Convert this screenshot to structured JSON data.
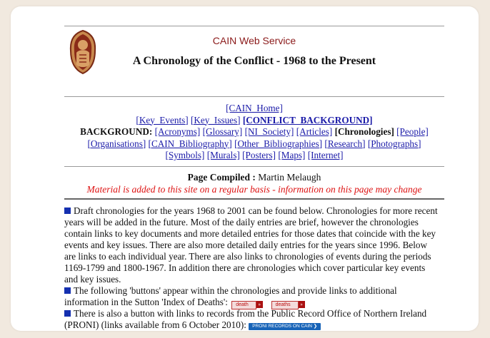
{
  "header": {
    "service": "CAIN Web Service",
    "title": "A Chronology of the Conflict - 1968 to the Present"
  },
  "nav": {
    "home": "[CAIN_Home]",
    "row2": [
      "[Key_Events]",
      "[Key_Issues]"
    ],
    "conflict_background": "[CONFLICT_BACKGROUND]",
    "background_label": "BACKGROUND:",
    "row3": [
      "[Acronyms]",
      "[Glossary]",
      "[NI_Society]",
      "[Articles]"
    ],
    "chronologies": "[Chronologies]",
    "people": "[People]",
    "row4": [
      "[Organisations]",
      "[CAIN_Bibliography]",
      "[Other_Bibliographies]",
      "[Research]",
      "[Photographs]"
    ],
    "row5": [
      "[Symbols]",
      "[Murals]",
      "[Posters]",
      "[Maps]",
      "[Internet]"
    ]
  },
  "compiled": {
    "label": "Page Compiled :",
    "author": "Martin Melaugh",
    "notice": "Material is added to this site on a regular basis - information on this page may change"
  },
  "body": {
    "para1": "Draft chronologies for the years 1968 to 2001 can be found below. Chronologies for more recent years will be added in the future. Most of the daily entries are brief, however the chronologies contain links to key documents and more detailed entries for those dates that coincide with the key events and key issues. There are also more detailed daily entries for the years since 1996. Below are links to each individual year. There are also links to chronologies of events during the periods 1169-1799 and 1800-1967. In addition there are chronologies which cover particular key events and key issues.",
    "para2": "The following 'buttons' appear within the chronologies and provide links to additional information in the Sutton 'Index of Deaths':",
    "btn_death": "death",
    "btn_deaths": "deaths",
    "arrow": "»",
    "para3": "There is also a button with links to records from the Public Record Office of Northern Ireland (PRONI) (links available from 6 October 2010):",
    "btn_proni": "PRONI RECORDS ON CAIN ❯"
  },
  "colors": {
    "link": "#1a1aa8",
    "notice": "#dd1111",
    "bullet": "#1530b0",
    "service": "#8b1a1a"
  }
}
